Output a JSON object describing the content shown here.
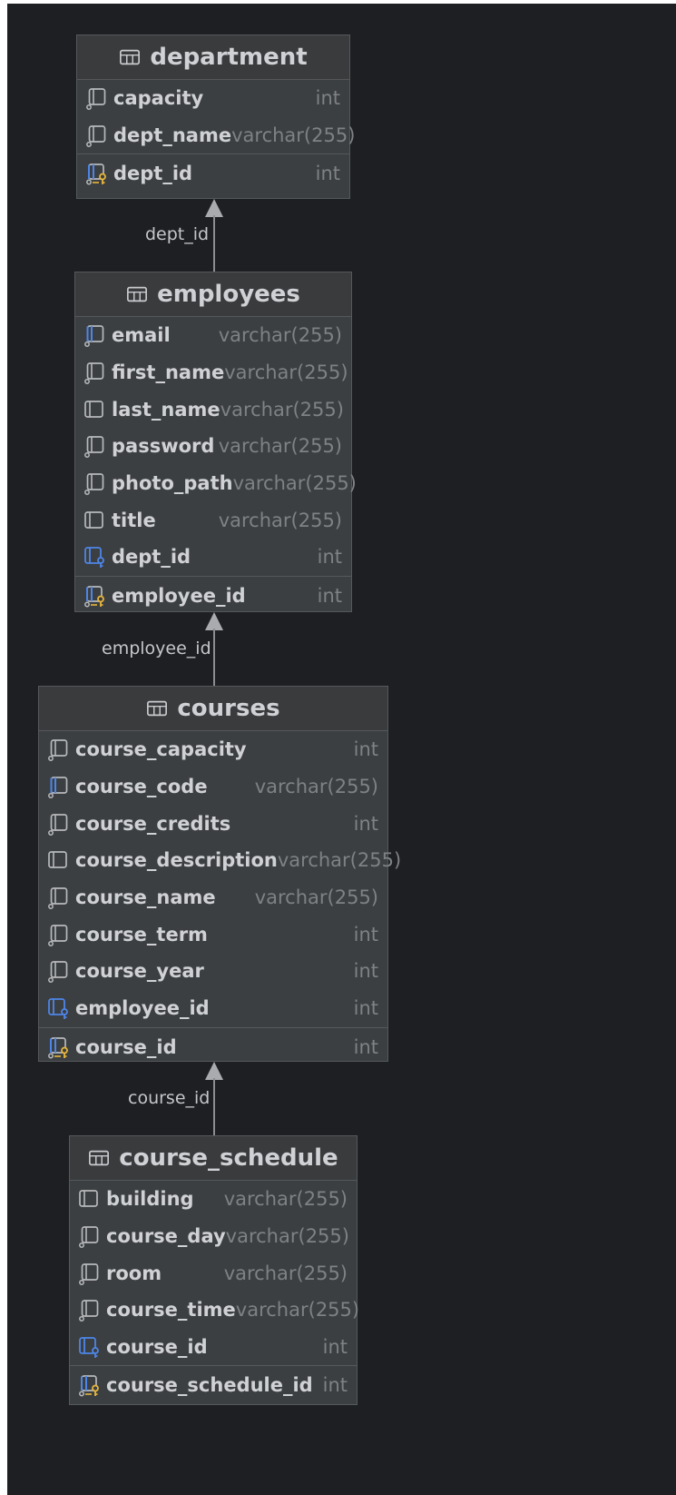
{
  "relations": [
    {
      "label": "dept_id"
    },
    {
      "label": "employee_id"
    },
    {
      "label": "course_id"
    }
  ],
  "tables": [
    {
      "name": "department",
      "columns": [
        {
          "name": "capacity",
          "type": "int",
          "icon": "column-icon"
        },
        {
          "name": "dept_name",
          "type": "varchar(255)",
          "icon": "column-icon"
        }
      ],
      "pk": {
        "name": "dept_id",
        "type": "int",
        "icon": "primary-key-icon"
      }
    },
    {
      "name": "employees",
      "columns": [
        {
          "name": "email",
          "type": "varchar(255)",
          "icon": "unique-column-icon"
        },
        {
          "name": "first_name",
          "type": "varchar(255)",
          "icon": "column-icon"
        },
        {
          "name": "last_name",
          "type": "varchar(255)",
          "icon": "nullable-column-icon"
        },
        {
          "name": "password",
          "type": "varchar(255)",
          "icon": "column-icon"
        },
        {
          "name": "photo_path",
          "type": "varchar(255)",
          "icon": "column-icon"
        },
        {
          "name": "title",
          "type": "varchar(255)",
          "icon": "nullable-column-icon"
        },
        {
          "name": "dept_id",
          "type": "int",
          "icon": "foreign-key-icon"
        }
      ],
      "pk": {
        "name": "employee_id",
        "type": "int",
        "icon": "primary-key-icon"
      }
    },
    {
      "name": "courses",
      "columns": [
        {
          "name": "course_capacity",
          "type": "int",
          "icon": "column-icon"
        },
        {
          "name": "course_code",
          "type": "varchar(255)",
          "icon": "unique-column-icon"
        },
        {
          "name": "course_credits",
          "type": "int",
          "icon": "column-icon"
        },
        {
          "name": "course_description",
          "type": "varchar(255)",
          "icon": "nullable-column-icon"
        },
        {
          "name": "course_name",
          "type": "varchar(255)",
          "icon": "column-icon"
        },
        {
          "name": "course_term",
          "type": "int",
          "icon": "column-icon"
        },
        {
          "name": "course_year",
          "type": "int",
          "icon": "column-icon"
        },
        {
          "name": "employee_id",
          "type": "int",
          "icon": "foreign-key-icon"
        }
      ],
      "pk": {
        "name": "course_id",
        "type": "int",
        "icon": "primary-key-icon"
      }
    },
    {
      "name": "course_schedule",
      "columns": [
        {
          "name": "building",
          "type": "varchar(255)",
          "icon": "nullable-column-icon"
        },
        {
          "name": "course_day",
          "type": "varchar(255)",
          "icon": "column-icon"
        },
        {
          "name": "room",
          "type": "varchar(255)",
          "icon": "column-icon"
        },
        {
          "name": "course_time",
          "type": "varchar(255)",
          "icon": "column-icon"
        },
        {
          "name": "course_id",
          "type": "int",
          "icon": "foreign-key-icon"
        }
      ],
      "pk": {
        "name": "course_schedule_id",
        "type": "int",
        "icon": "primary-key-icon"
      }
    }
  ]
}
